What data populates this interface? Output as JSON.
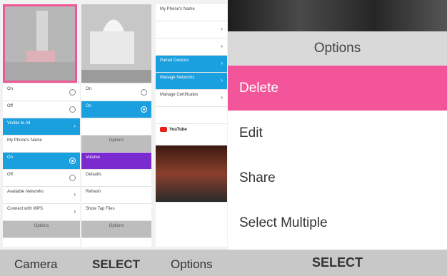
{
  "left_screen": {
    "thumbnails": {
      "photo1_alt": "",
      "photo2_alt": ""
    },
    "wifi_col": {
      "rows": [
        {
          "text": "On",
          "kind": "radio-selected"
        },
        {
          "text": "Off",
          "kind": "radio"
        },
        {
          "text": "Visible to All",
          "kind": "blue-chevron"
        },
        {
          "text": "My Phone's Name",
          "kind": "plain"
        },
        {
          "text": "On",
          "kind": "blue-radio"
        },
        {
          "text": "Off",
          "kind": "radio"
        },
        {
          "text": "Available Networks",
          "kind": "chevron"
        },
        {
          "text": "Connect with WPS",
          "kind": "chevron"
        },
        {
          "text": "Options",
          "kind": "gray"
        }
      ]
    },
    "mid_col": {
      "rows": [
        {
          "text": "On",
          "kind": "radio"
        },
        {
          "text": "On",
          "kind": "blue-radio"
        },
        {
          "text": "",
          "kind": "plain"
        },
        {
          "text": "Options",
          "kind": "gray"
        },
        {
          "text": "Volume",
          "kind": "purple"
        },
        {
          "text": "Defaults",
          "kind": "plain"
        },
        {
          "text": "Refresh",
          "kind": "plain"
        },
        {
          "text": "Show Tap Files",
          "kind": "plain"
        },
        {
          "text": "Options",
          "kind": "gray"
        }
      ]
    },
    "right_col": {
      "rows": [
        {
          "text": "My Phone's Name",
          "kind": "plain"
        },
        {
          "text": "",
          "kind": "chevron"
        },
        {
          "text": "",
          "kind": "chevron"
        },
        {
          "text": "Paired Devices",
          "kind": "blue-chevron"
        },
        {
          "text": "Manage Networks",
          "kind": "blue-chevron"
        },
        {
          "text": "Manage Certificates",
          "kind": "chevron"
        },
        {
          "text": "",
          "kind": "plain"
        },
        {
          "text": "YouTube",
          "kind": "youtube"
        },
        {
          "text": "",
          "kind": "video"
        }
      ]
    },
    "softkeys": {
      "left": "Camera",
      "center": "SELECT",
      "right": "Options"
    }
  },
  "right_screen": {
    "title": "Options",
    "menu": [
      {
        "label": "Delete",
        "selected": true
      },
      {
        "label": "Edit",
        "selected": false
      },
      {
        "label": "Share",
        "selected": false
      },
      {
        "label": "Select Multiple",
        "selected": false
      }
    ],
    "softkey_center": "SELECT"
  },
  "colors": {
    "accent_pink": "#f2559a",
    "list_blue": "#1a9fdf",
    "softkey_bar": "#c8c8c8",
    "purple": "#7b2ad0",
    "youtube_red": "#e62117"
  }
}
